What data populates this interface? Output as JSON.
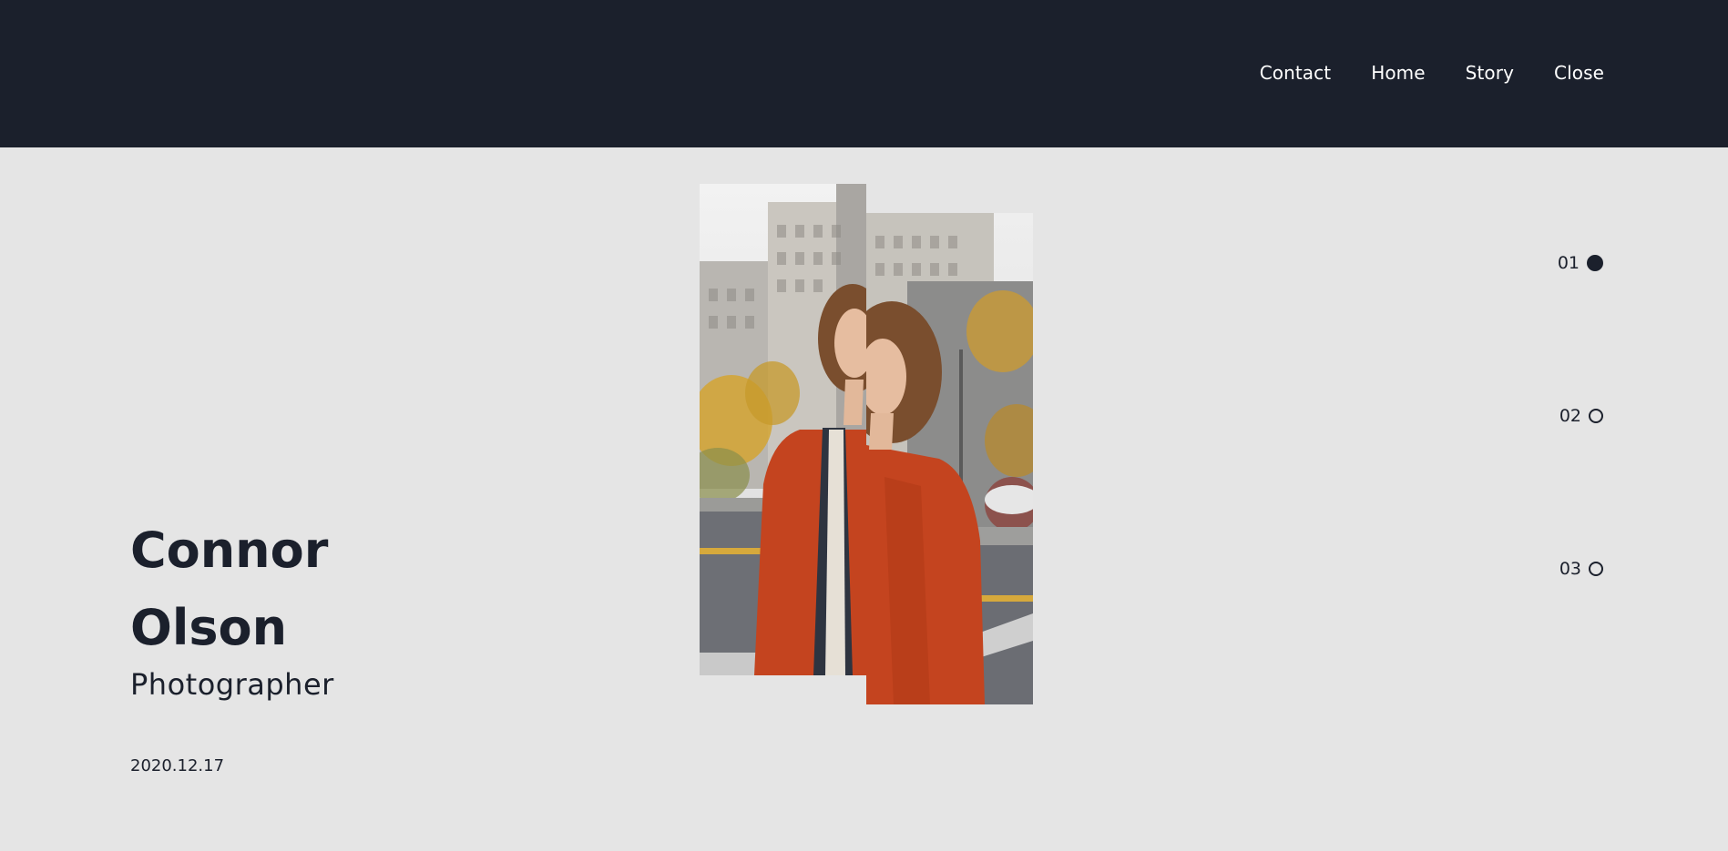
{
  "nav": {
    "items": [
      {
        "label": "Contact"
      },
      {
        "label": "Home"
      },
      {
        "label": "Story"
      },
      {
        "label": "Close"
      }
    ]
  },
  "hero": {
    "first_name": "Connor",
    "last_name": "Olson",
    "role": "Photographer",
    "date": "2020.12.17",
    "image_alt": "Portrait of a woman in an orange jacket standing on a city street"
  },
  "slides": [
    {
      "number": "01",
      "active": true
    },
    {
      "number": "02",
      "active": false
    },
    {
      "number": "03",
      "active": false
    }
  ],
  "colors": {
    "header_bg": "#1b202c",
    "page_bg": "#e5e5e5",
    "text_dark": "#1b202c",
    "text_light": "#ffffff",
    "jacket": "#c4441f"
  }
}
